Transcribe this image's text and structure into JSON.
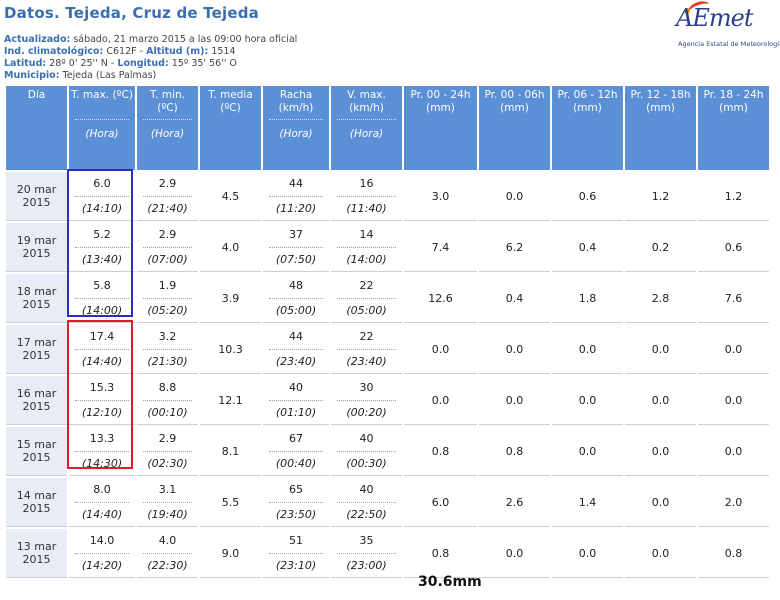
{
  "header": {
    "title": "Datos. Tejeda, Cruz de Tejeda",
    "updated_label": "Actualizado:",
    "updated_value": "sábado, 21 marzo 2015 a las 09:00 hora oficial",
    "ind_label": "Ind. climatológico:",
    "ind_value": "C612F -",
    "alt_label": "Altitud (m):",
    "alt_value": "1514",
    "lat_label": "Latitud:",
    "lat_value": "28º 0' 25'' N -",
    "lon_label": "Longitud:",
    "lon_value": "15º 35' 56'' O",
    "mun_label": "Municipio:",
    "mun_value": "Tejeda (Las Palmas)"
  },
  "logo": {
    "wordmark": "AEmet",
    "tagline": "Agencia Estatal de Meteorología"
  },
  "columns": [
    {
      "label": "Día",
      "sub": ""
    },
    {
      "label": "T. max. (ºC)",
      "sub": "(Hora)"
    },
    {
      "label": "T. min. (ºC)",
      "sub": "(Hora)"
    },
    {
      "label": "T. media (ºC)",
      "sub": ""
    },
    {
      "label": "Racha (km/h)",
      "sub": "(Hora)"
    },
    {
      "label": "V. max. (km/h)",
      "sub": "(Hora)"
    },
    {
      "label": "Pr. 00 - 24h (mm)",
      "sub": ""
    },
    {
      "label": "Pr. 00 - 06h (mm)",
      "sub": ""
    },
    {
      "label": "Pr. 06 - 12h (mm)",
      "sub": ""
    },
    {
      "label": "Pr. 12 - 18h (mm)",
      "sub": ""
    },
    {
      "label": "Pr. 18 - 24h (mm)",
      "sub": ""
    }
  ],
  "rows": [
    {
      "day": "20 mar 2015",
      "tmax": "6.0",
      "tmax_h": "(14:10)",
      "tmin": "2.9",
      "tmin_h": "(21:40)",
      "tmed": "4.5",
      "racha": "44",
      "racha_h": "(11:20)",
      "vmax": "16",
      "vmax_h": "(11:40)",
      "p24": "3.0",
      "p06": "0.0",
      "p12": "0.6",
      "p18": "1.2",
      "p24b": "1.2"
    },
    {
      "day": "19 mar 2015",
      "tmax": "5.2",
      "tmax_h": "(13:40)",
      "tmin": "2.9",
      "tmin_h": "(07:00)",
      "tmed": "4.0",
      "racha": "37",
      "racha_h": "(07:50)",
      "vmax": "14",
      "vmax_h": "(14:00)",
      "p24": "7.4",
      "p06": "6.2",
      "p12": "0.4",
      "p18": "0.2",
      "p24b": "0.6"
    },
    {
      "day": "18 mar 2015",
      "tmax": "5.8",
      "tmax_h": "(14:00)",
      "tmin": "1.9",
      "tmin_h": "(05:20)",
      "tmed": "3.9",
      "racha": "48",
      "racha_h": "(05:00)",
      "vmax": "22",
      "vmax_h": "(05:00)",
      "p24": "12.6",
      "p06": "0.4",
      "p12": "1.8",
      "p18": "2.8",
      "p24b": "7.6"
    },
    {
      "day": "17 mar 2015",
      "tmax": "17.4",
      "tmax_h": "(14:40)",
      "tmin": "3.2",
      "tmin_h": "(21:30)",
      "tmed": "10.3",
      "racha": "44",
      "racha_h": "(23:40)",
      "vmax": "22",
      "vmax_h": "(23:40)",
      "p24": "0.0",
      "p06": "0.0",
      "p12": "0.0",
      "p18": "0.0",
      "p24b": "0.0"
    },
    {
      "day": "16 mar 2015",
      "tmax": "15.3",
      "tmax_h": "(12:10)",
      "tmin": "8.8",
      "tmin_h": "(00:10)",
      "tmed": "12.1",
      "racha": "40",
      "racha_h": "(01:10)",
      "vmax": "30",
      "vmax_h": "(00:20)",
      "p24": "0.0",
      "p06": "0.0",
      "p12": "0.0",
      "p18": "0.0",
      "p24b": "0.0"
    },
    {
      "day": "15 mar 2015",
      "tmax": "13.3",
      "tmax_h": "(14:30)",
      "tmin": "2.9",
      "tmin_h": "(02:30)",
      "tmed": "8.1",
      "racha": "67",
      "racha_h": "(00:40)",
      "vmax": "40",
      "vmax_h": "(00:30)",
      "p24": "0.8",
      "p06": "0.8",
      "p12": "0.0",
      "p18": "0.0",
      "p24b": "0.0"
    },
    {
      "day": "14 mar 2015",
      "tmax": "8.0",
      "tmax_h": "(14:40)",
      "tmin": "3.1",
      "tmin_h": "(19:40)",
      "tmed": "5.5",
      "racha": "65",
      "racha_h": "(23:50)",
      "vmax": "40",
      "vmax_h": "(22:50)",
      "p24": "6.0",
      "p06": "2.6",
      "p12": "1.4",
      "p18": "0.0",
      "p24b": "2.0"
    },
    {
      "day": "13 mar 2015",
      "tmax": "14.0",
      "tmax_h": "(14:20)",
      "tmin": "4.0",
      "tmin_h": "(22:30)",
      "tmed": "9.0",
      "racha": "51",
      "racha_h": "(23:10)",
      "vmax": "35",
      "vmax_h": "(23:00)",
      "p24": "0.8",
      "p06": "0.0",
      "p12": "0.0",
      "p18": "0.0",
      "p24b": "0.8"
    }
  ],
  "annotation": {
    "total": "30.6mm",
    "blue_box_color": "#2a2fbf",
    "red_box_color": "#d8202c"
  },
  "colors": {
    "header_bg": "#5b8fd6",
    "title": "#3a6fb0",
    "day_bg": "#e8edf5"
  }
}
